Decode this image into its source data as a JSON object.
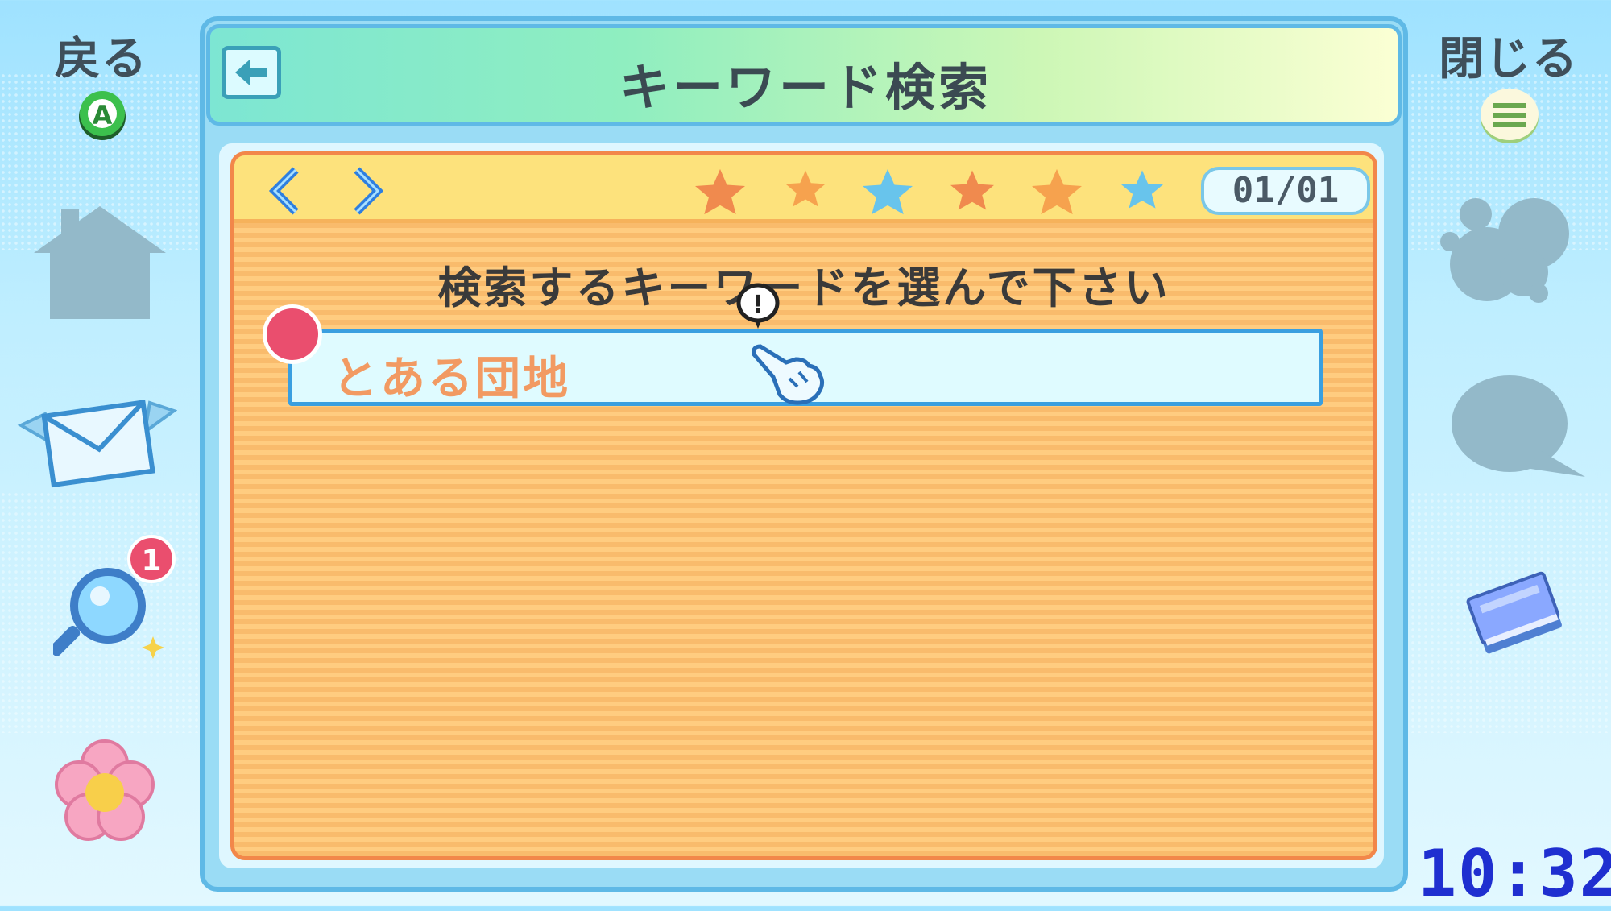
{
  "left_menu": {
    "back_label": "戻る",
    "back_button_glyph": "A",
    "search_badge_count": "1",
    "icons": [
      "house-icon",
      "mail-icon",
      "magnifier-icon",
      "flower-icon"
    ]
  },
  "right_menu": {
    "close_label": "閉じる",
    "icons": [
      "menu-icon",
      "thought-bubble-icon",
      "speech-bubble-icon",
      "book-icon"
    ]
  },
  "window": {
    "title": "キーワード検索",
    "page_counter": "01/01",
    "stars": [
      "orange",
      "orange",
      "blue",
      "orange",
      "orange",
      "blue"
    ],
    "prompt": "検索するキーワードを選んで下さい",
    "keywords": [
      {
        "label": "とある団地",
        "new_marker": true
      }
    ],
    "cursor_alert": "!"
  },
  "clock": "10:32",
  "colors": {
    "accent_blue": "#3a9fe0",
    "panel_orange": "#f9bb6c",
    "marker_red": "#ea4e6e",
    "keyword_text": "#f29a62",
    "clock_blue": "#1f2fd0"
  }
}
